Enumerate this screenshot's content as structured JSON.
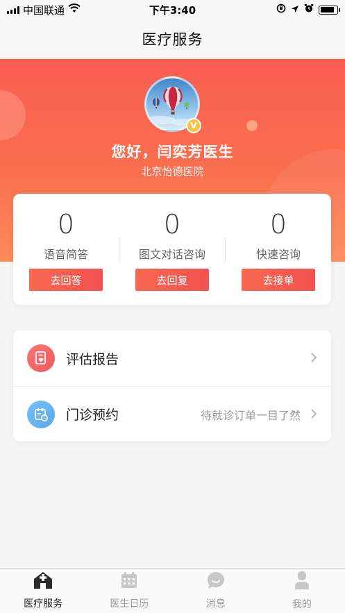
{
  "status_bar": {
    "carrier": "中国联通",
    "time": "下午3:40",
    "battery_level": 0.85
  },
  "nav": {
    "title": "医疗服务"
  },
  "profile": {
    "greeting": "您好，闫奕芳医生",
    "hospital": "北京怡德医院",
    "badge": "V"
  },
  "stats": [
    {
      "count": "0",
      "label": "语音简答",
      "button": "去回答"
    },
    {
      "count": "0",
      "label": "图文对话咨询",
      "button": "去回复"
    },
    {
      "count": "0",
      "label": "快速咨询",
      "button": "去接单"
    }
  ],
  "menu": [
    {
      "label": "评估报告",
      "desc": "",
      "icon": "report-icon"
    },
    {
      "label": "门诊预约",
      "desc": "待就诊订单一目了然",
      "icon": "calendar-clock-icon"
    }
  ],
  "tabs": [
    {
      "label": "医疗服务",
      "icon": "medical-service-icon",
      "active": true
    },
    {
      "label": "医生日历",
      "icon": "calendar-icon",
      "active": false
    },
    {
      "label": "消息",
      "icon": "message-icon",
      "active": false
    },
    {
      "label": "我的",
      "icon": "profile-icon",
      "active": false
    }
  ],
  "colors": {
    "accent": "#f96350",
    "header_gradient_top": "#fb5d52",
    "header_gradient_bottom": "#fb8a5a",
    "report_icon_bg": "#f26060",
    "appointment_icon_bg": "#62b2f2"
  }
}
